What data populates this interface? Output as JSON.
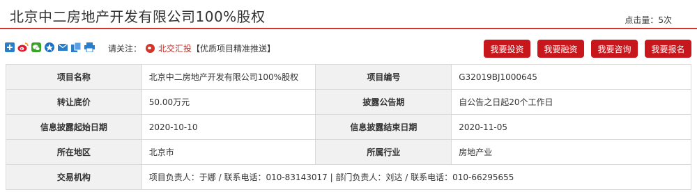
{
  "header": {
    "title": "北京中二房地产开发有限公司100%股权",
    "views": "点击量：5次"
  },
  "share": {
    "icons": [
      "plus-share-icon",
      "weibo-icon",
      "wechat-icon",
      "qzone-icon",
      "email-icon",
      "copy-icon",
      "print-icon"
    ],
    "attention_label": "请关注：",
    "brand": "北交汇投",
    "promo": "【优质项目精准推送】"
  },
  "actions": {
    "invest": "我要投资",
    "finance": "我要融资",
    "consult": "我要咨询",
    "signup": "我要报名"
  },
  "rows": [
    {
      "l1": "项目名称",
      "v1": "北京中二房地产开发有限公司100%股权",
      "l2": "项目编号",
      "v2": "G32019BJ1000645"
    },
    {
      "l1": "转让底价",
      "v1": "50.00万元",
      "l2": "披露公告期",
      "v2": "自公告之日起20个工作日"
    },
    {
      "l1": "信息披露起始日期",
      "v1": "2020-10-10",
      "l2": "信息披露结束日期",
      "v2": "2020-11-05"
    },
    {
      "l1": "所在地区",
      "v1": "北京市",
      "l2": "所属行业",
      "v2": "房地产业"
    }
  ],
  "agency": {
    "label": "交易机构",
    "value": "项目负责人：于娜 / 联系电话：010-83143017 | 部门负责人：刘达 / 联系电话：010-66295655"
  },
  "colors": {
    "accent": "#c8161d",
    "label_bg": "#f1f1f1",
    "border": "#d9d9d9"
  }
}
